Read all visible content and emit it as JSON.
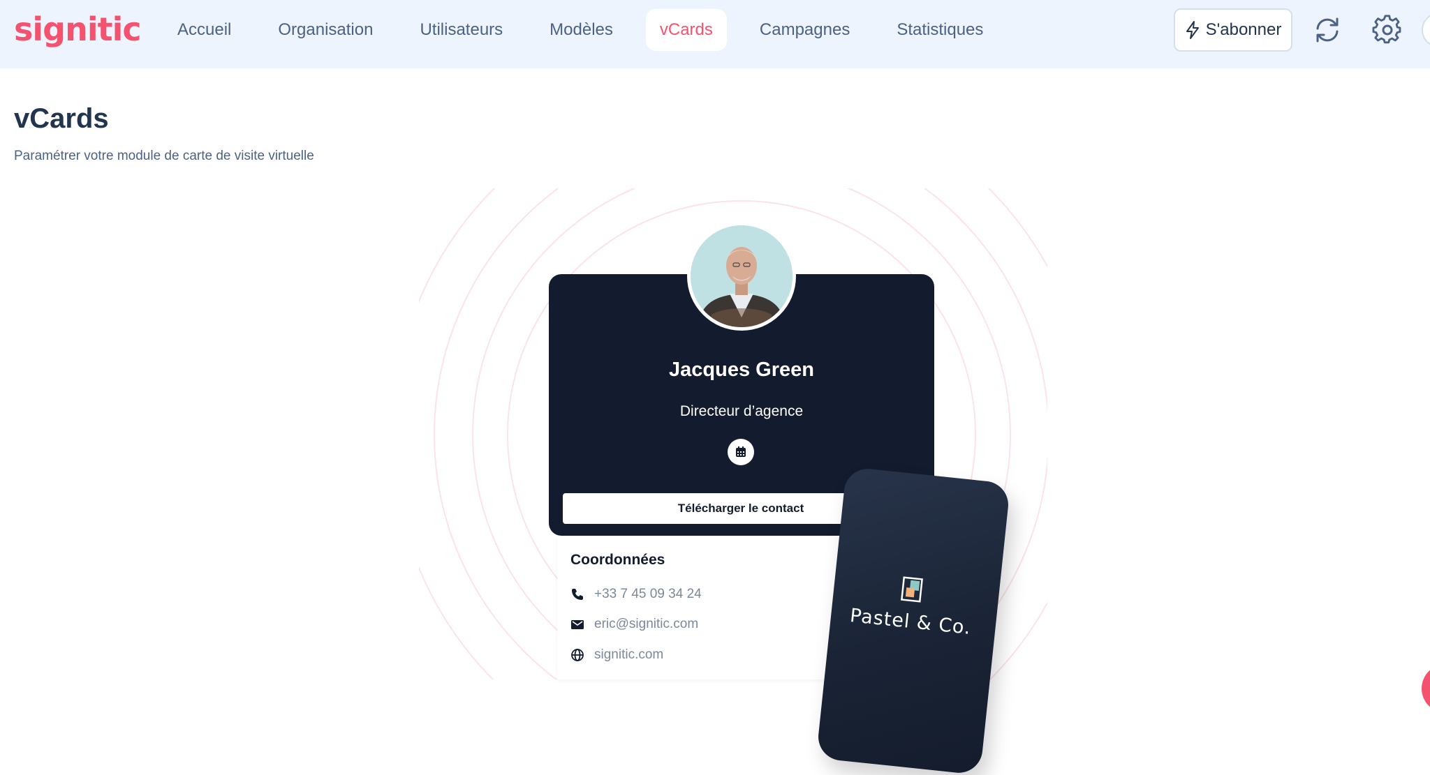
{
  "app": {
    "logo_text": "signitic",
    "brand_color": "#f4536f"
  },
  "nav": {
    "items": [
      {
        "label": "Accueil",
        "active": false
      },
      {
        "label": "Organisation",
        "active": false
      },
      {
        "label": "Utilisateurs",
        "active": false
      },
      {
        "label": "Modèles",
        "active": false
      },
      {
        "label": "vCards",
        "active": true
      },
      {
        "label": "Campagnes",
        "active": false
      },
      {
        "label": "Statistiques",
        "active": false
      }
    ]
  },
  "toolbar": {
    "subscribe_label": "S'abonner",
    "subscribe_icon": "lightning-icon",
    "refresh_icon": "refresh-icon",
    "settings_icon": "gear-icon"
  },
  "page": {
    "title": "vCards",
    "subtitle": "Paramétrer votre module de carte de visite virtuelle"
  },
  "vcard": {
    "name": "Jacques Green",
    "role": "Directeur d’agence",
    "calendar_icon": "calendar-icon",
    "download_label": "Télécharger le contact",
    "contact_title": "Coordonnées",
    "contacts": [
      {
        "icon": "phone-icon",
        "value": "+33 7 45 09 34 24"
      },
      {
        "icon": "mail-icon",
        "value": "eric@signitic.com"
      },
      {
        "icon": "globe-icon",
        "value": "signitic.com"
      }
    ],
    "card_color": "#131c2e"
  },
  "phone_mockup": {
    "brand": "Pastel & Co."
  }
}
